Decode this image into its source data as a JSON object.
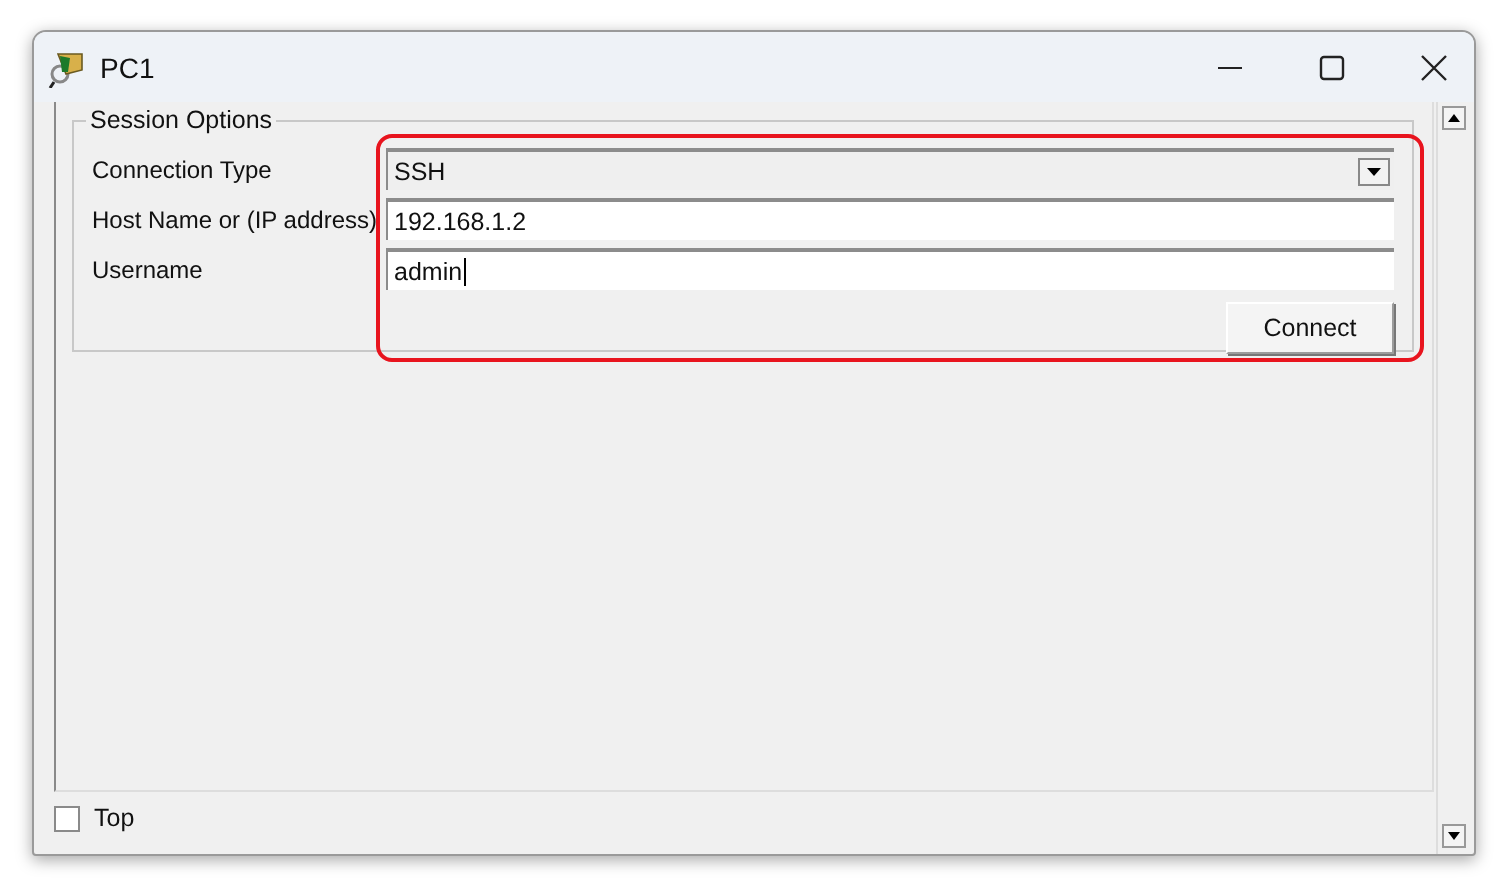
{
  "window": {
    "title": "PC1"
  },
  "session_options": {
    "title": "Session Options",
    "fields": [
      {
        "label": "Connection Type",
        "kind": "dropdown",
        "value": "SSH",
        "focused": false
      },
      {
        "label": "Host Name or (IP address)",
        "kind": "text",
        "value": "192.168.1.2",
        "focused": false
      },
      {
        "label": "Username",
        "kind": "text",
        "value": "admin",
        "focused": true
      }
    ],
    "connect_button": "Connect"
  },
  "top_checkbox": {
    "label": "Top",
    "checked": false
  }
}
